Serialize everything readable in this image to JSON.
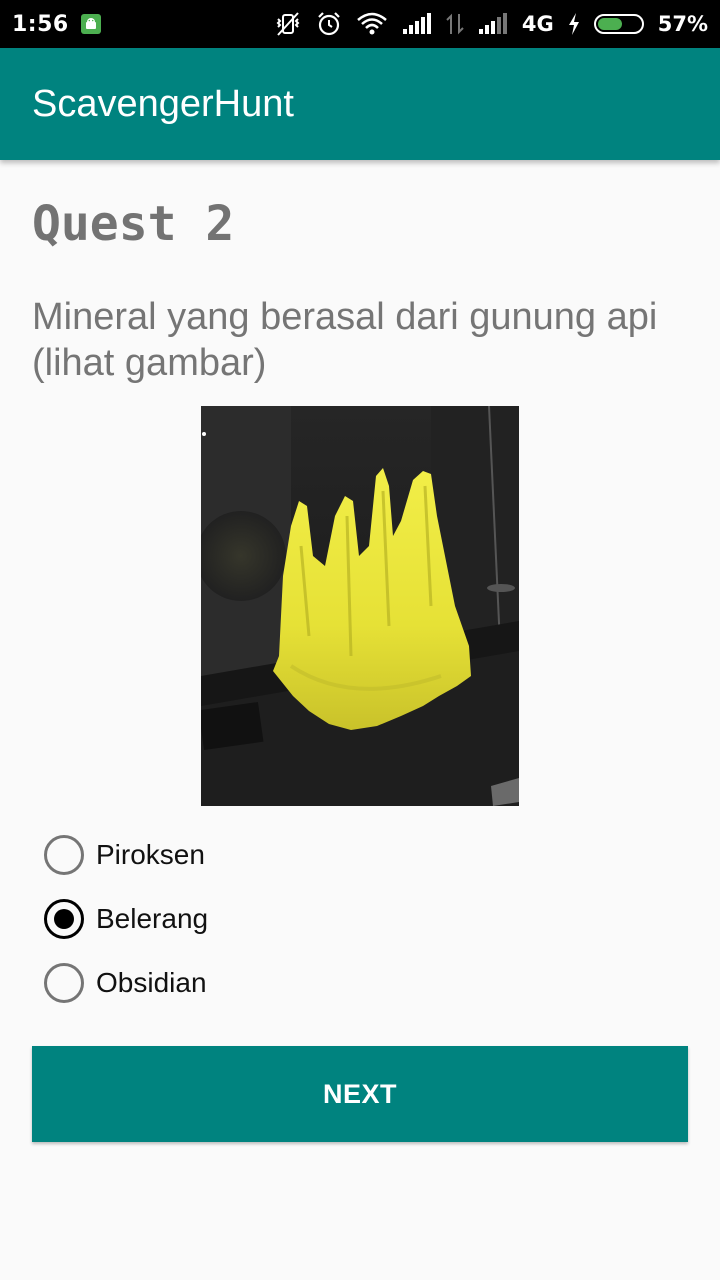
{
  "status_bar": {
    "time": "1:56",
    "network_type": "4G",
    "battery_percent": "57%",
    "battery_level": 0.57,
    "icons": [
      "android-notification-icon",
      "vibrate-off-icon",
      "alarm-icon",
      "wifi-icon",
      "signal-icon",
      "data-transfer-icon",
      "signal-icon-2",
      "charging-bolt-icon",
      "battery-icon"
    ]
  },
  "app_bar": {
    "title": "ScavengerHunt",
    "color": "#00837f"
  },
  "quest": {
    "title": "Quest 2",
    "question": "Mineral yang berasal dari gunung api (lihat gambar)",
    "image_subject": "yellow sulfur mineral specimen"
  },
  "options": [
    {
      "label": "Piroksen",
      "checked": false
    },
    {
      "label": "Belerang",
      "checked": true
    },
    {
      "label": "Obsidian",
      "checked": false
    }
  ],
  "next_button": {
    "label": "NEXT"
  }
}
